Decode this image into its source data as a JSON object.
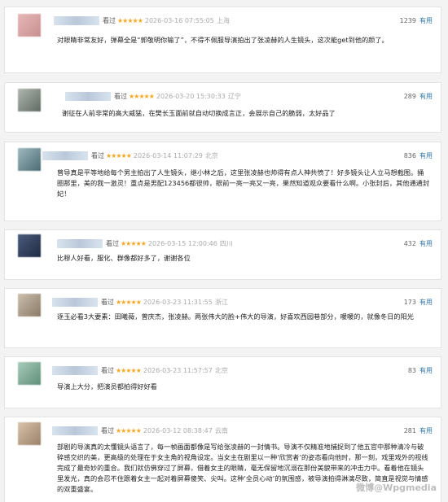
{
  "comments": [
    {
      "seen": "看过",
      "stars": "★★★★★",
      "time": "2026-03-16 07:55:05",
      "location": "上海",
      "votes": "1239",
      "useful": "有用",
      "content": "对眼睛非常友好，弹幕全是“郭敬明你输了”，不得不佩服导演拍出了张凌赫的人生镜头，这次能get到他的颜了。"
    },
    {
      "seen": "看过",
      "stars": "★★★★★",
      "time": "2026-03-20 15:30:33",
      "location": "辽宁",
      "votes": "289",
      "useful": "有用",
      "content": "谢征在人前非常的高大威猛，在樊长玉面前就自动切换成言正，会展示自己的脆弱，太好品了"
    },
    {
      "seen": "看过",
      "stars": "★★★★★",
      "time": "2026-03-14 11:07:29",
      "location": "北京",
      "votes": "836",
      "useful": "有用",
      "content": "曾导真是平等地给每个男主拍出了人生镜头，继小林之后，这里张凌赫也帅得有点人神共愤了！好多镜头让人立马想截图。捅圈那里，美的我一激灵！重点是男配123456都很帅，眼前一亮一亮又一亮，果然知道观众要看什么啊。小张封后，其他通通封妃！"
    },
    {
      "seen": "看过",
      "stars": "★★★★★",
      "time": "2026-03-15 12:00:46",
      "location": "四川",
      "votes": "432",
      "useful": "有用",
      "content": "比穆人好看，服化、群像都好多了，谢谢各位"
    },
    {
      "seen": "看过",
      "stars": "★★★★★",
      "time": "2026-03-23 11:31:55",
      "location": "浙江",
      "votes": "173",
      "useful": "有用",
      "content": "逐玉必看3大要素：田曦薇，曾庆杰，张凌赫。两张伟大的脸+伟大的导演，好喜欢西园巷部分，暖暖的，就像冬日的阳光"
    },
    {
      "seen": "看过",
      "stars": "★★★★★",
      "time": "2026-03-23 11:57:57",
      "location": "北京",
      "votes": "83",
      "useful": "有用",
      "content": "导演上大分，把演员都拍得好好看"
    },
    {
      "seen": "看过",
      "stars": "★★★★★",
      "time": "2026-03-12 08:38:47",
      "location": "云南",
      "votes": "281",
      "useful": "有用",
      "content": "部剧的导演真的太懂镜头语言了，每一帧画面都像是写给张凌赫的一封情书。导演不仅精准地捕捉到了他五官中那种清冷与破碎感交织的美，更高级的处理在于女主角的视角设定。当女主在剧里以一种‘欣赏者’的姿态看向他时，那一刻，戏里戏外的视线完成了最奇妙的重合。我们就仿佛穿过了屏幕，借着女主的眼睛，毫无保留地沉溺在那份美貌带来的冲击力中。看着他在镜头里发光，真的会忍不住跟着女主一起对着屏幕傻笑、尖叫。这种‘全员心动’的氛围感，被导演拍得淋漓尽致，简直是视觉与情感的双重盛宴。"
    }
  ],
  "watermark": "微博@Wpgmedia"
}
